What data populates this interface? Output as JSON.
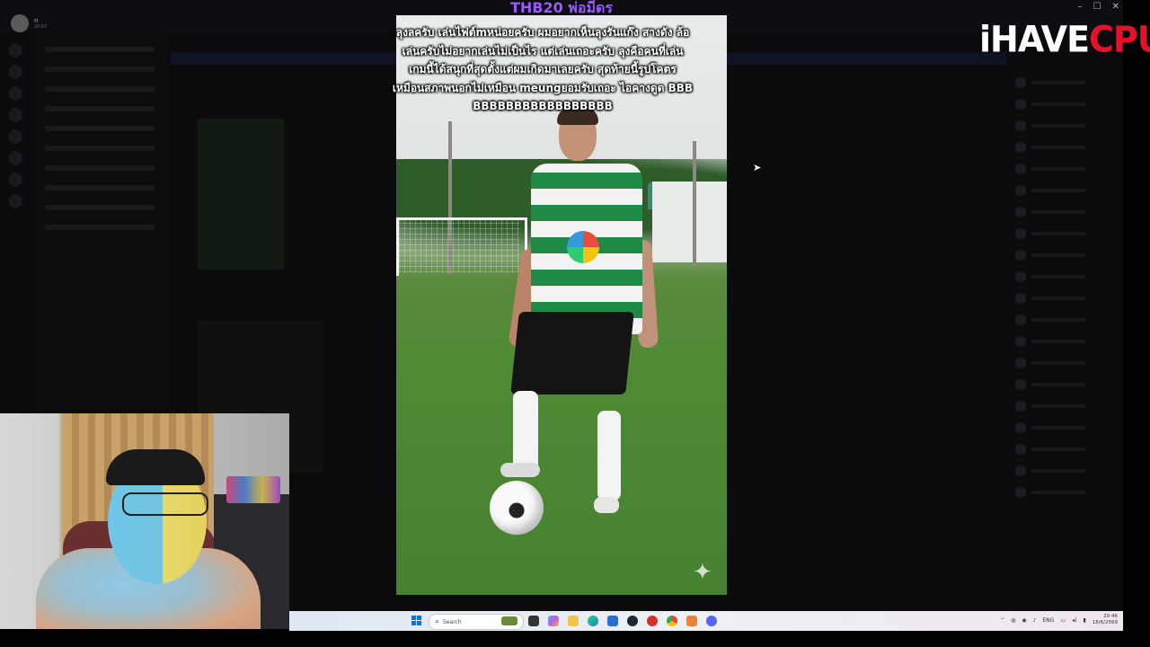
{
  "background_app": {
    "user_name": "n",
    "user_status": "20:07"
  },
  "window_controls": {
    "minimize": "–",
    "maximize": "☐",
    "close": "✕"
  },
  "donation": {
    "title": "THB20 พ่อมีดร",
    "tts_lines": [
      "ลุงลครับ เล่นไฟต์mหน่อยครับ ผมอยากเห็นลุงรันแก๊ง สางดัง ล้อ",
      "เล่นครับไม่อยากเล่นไม่เป็นไร แต่เล่นเถอะครับ ลุงคือคนที่เล่น",
      "เกมนี้ได้สนุกที่สุดตั้งแต่ผมเกิดมาเลยครับ สุดท้ายนี้รูปโคตร",
      "เหมือนสภาพนอกไม่เหมือน meungยอมรับเถอะ ไอคางดูด BBB",
      "BBBBBBBBBBBBBBBBB"
    ]
  },
  "brand": {
    "part1": "iHAVE",
    "part2": "CPU",
    "color_accent": "#e3122a"
  },
  "taskbar": {
    "search_placeholder": "Search",
    "language": "ENG",
    "time": "20:46",
    "date": "18/6/2569",
    "apps": [
      "file-explorer-icon",
      "copilot-icon",
      "folder-icon",
      "edge-icon",
      "store-icon",
      "steam-icon",
      "app-red-icon",
      "chrome-icon",
      "app-orange-icon",
      "discord-icon"
    ]
  }
}
